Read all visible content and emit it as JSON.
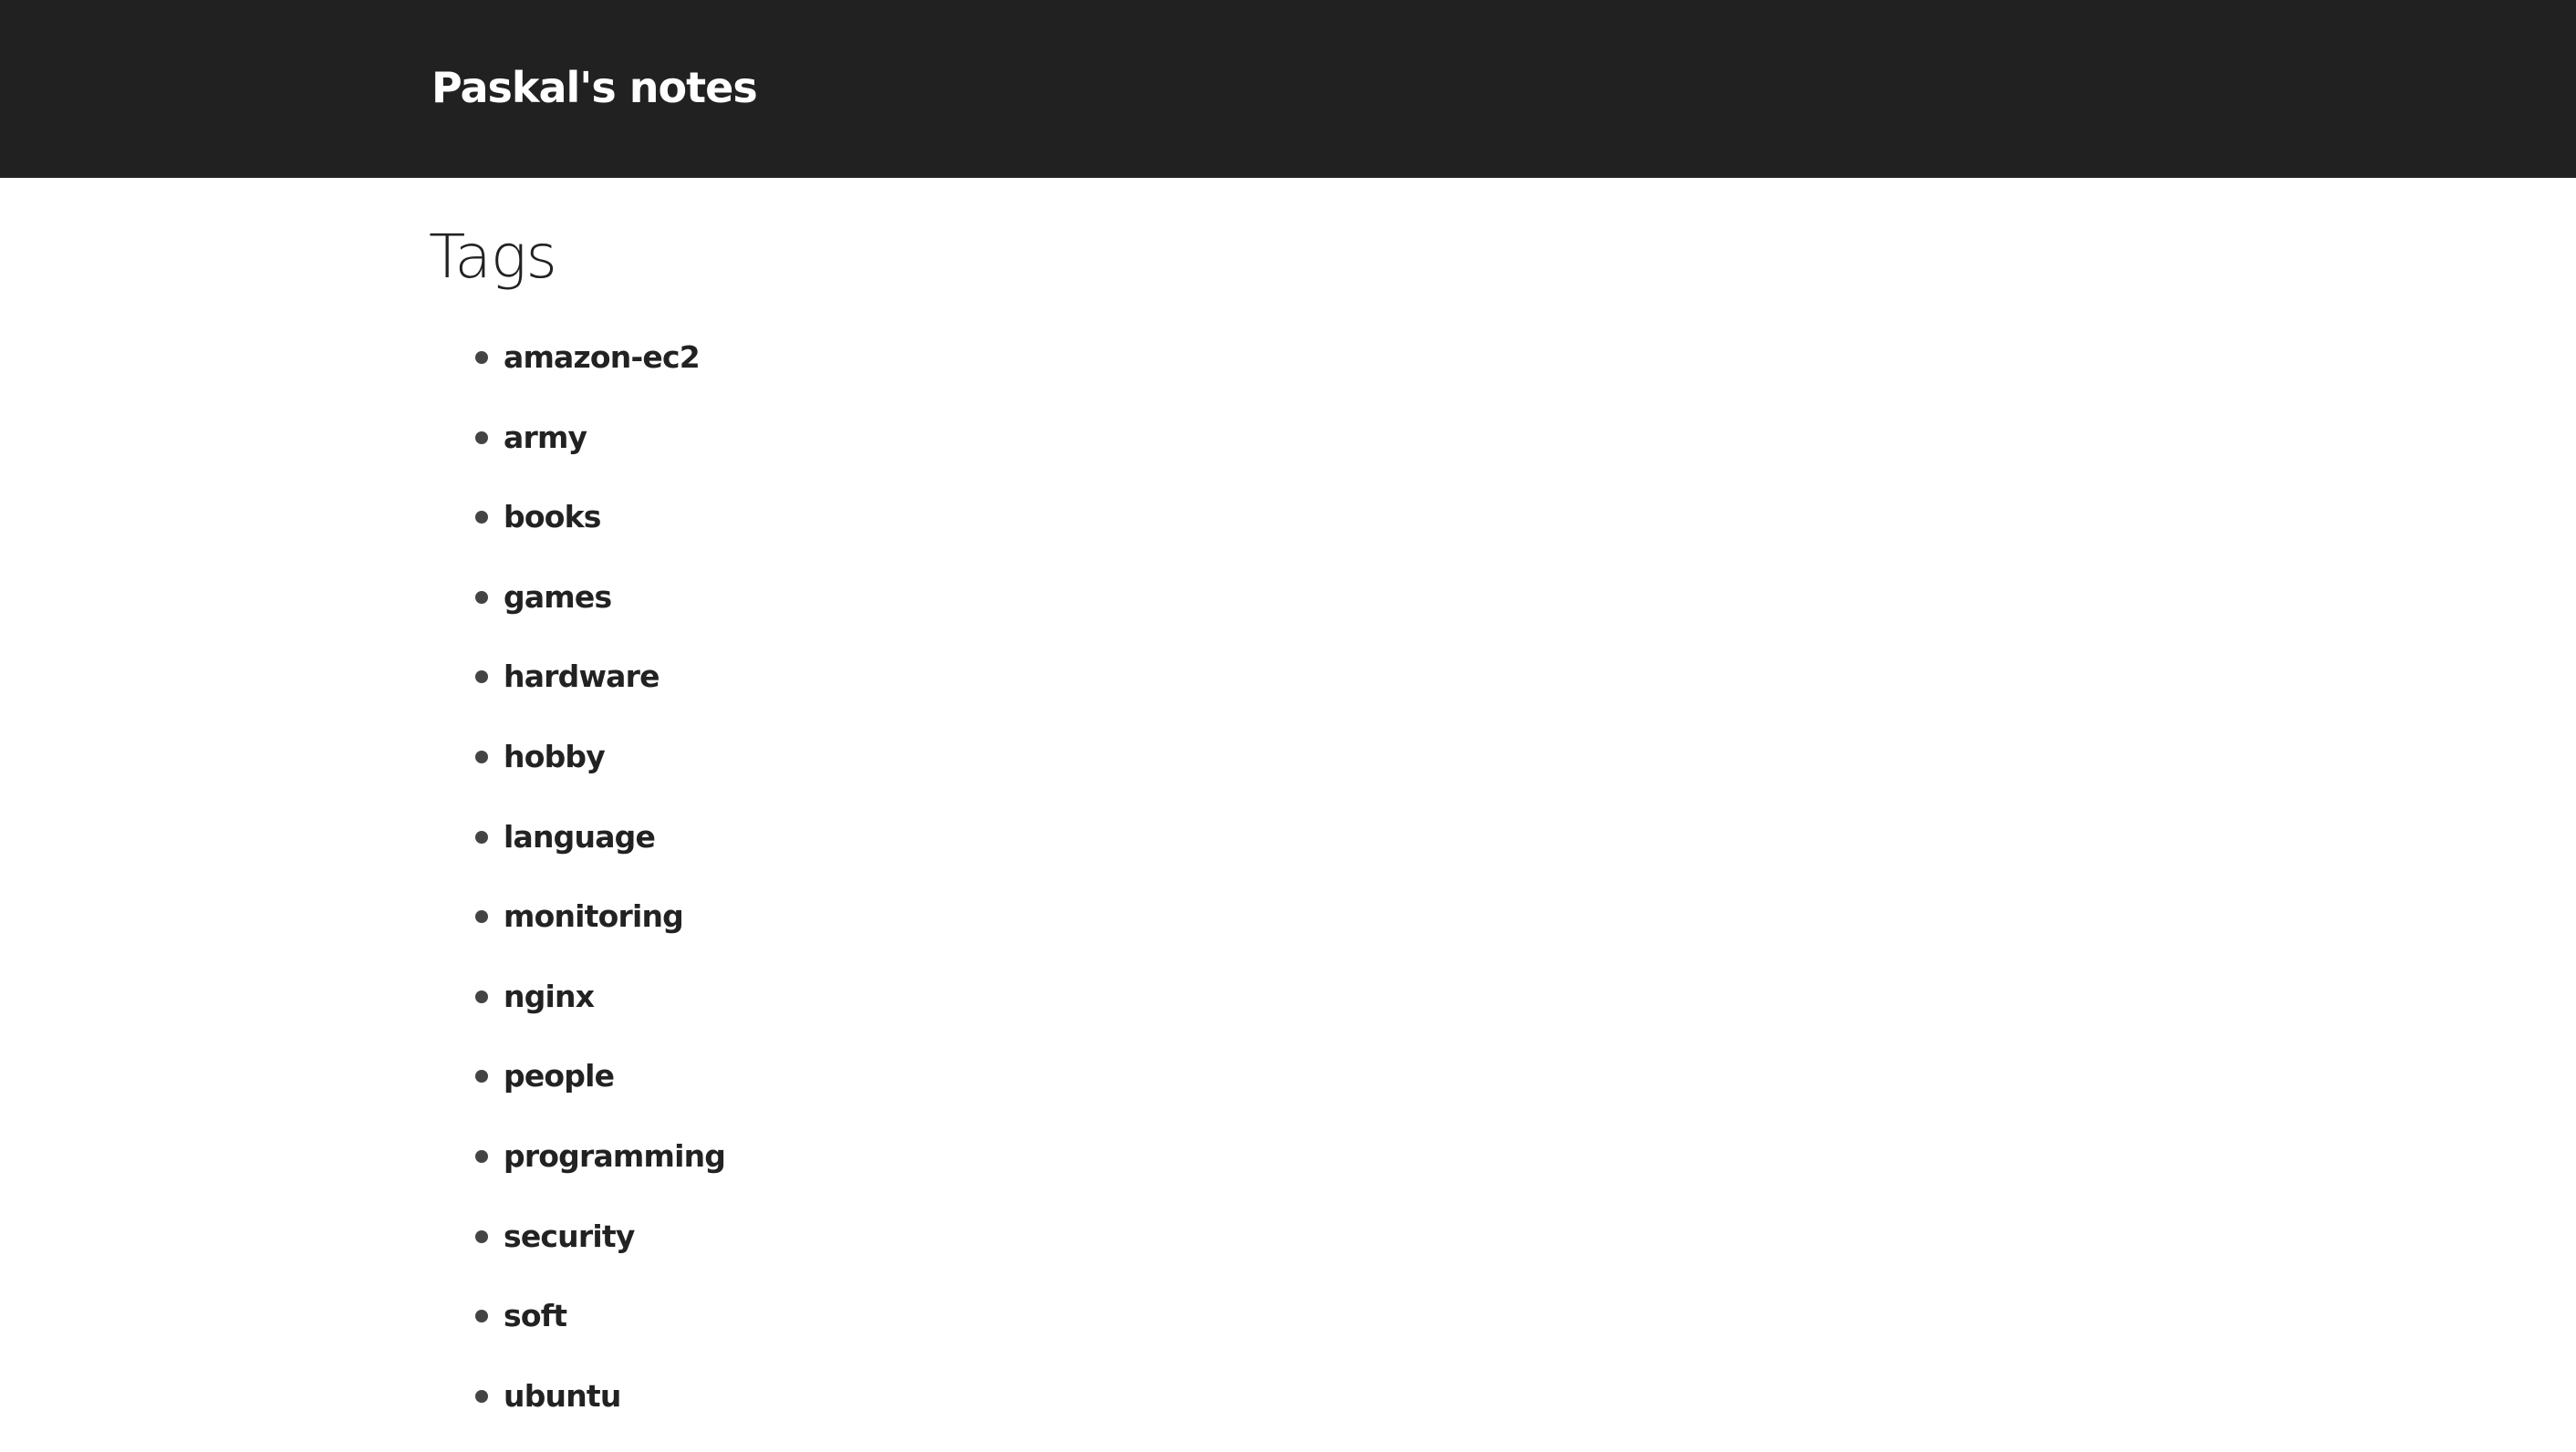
{
  "header": {
    "site_title": "Paskal's notes",
    "background_color": "#212121"
  },
  "main": {
    "page_title": "Tags",
    "tags": [
      {
        "label": "amazon-ec2"
      },
      {
        "label": "army"
      },
      {
        "label": "books"
      },
      {
        "label": "games"
      },
      {
        "label": "hardware"
      },
      {
        "label": "hobby"
      },
      {
        "label": "language"
      },
      {
        "label": "monitoring"
      },
      {
        "label": "nginx"
      },
      {
        "label": "people"
      },
      {
        "label": "programming"
      },
      {
        "label": "security"
      },
      {
        "label": "soft"
      },
      {
        "label": "ubuntu"
      }
    ]
  }
}
